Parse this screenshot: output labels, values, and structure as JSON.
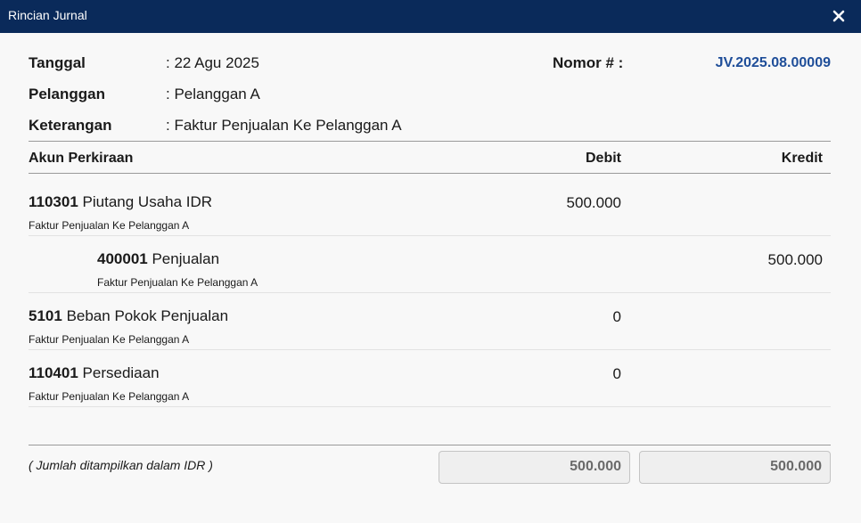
{
  "window": {
    "title": "Rincian Jurnal",
    "close_icon": "close-icon"
  },
  "header": {
    "tanggal_label": "Tanggal",
    "tanggal_value": ": 22 Agu 2025",
    "pelanggan_label": "Pelanggan",
    "pelanggan_value": ": Pelanggan A",
    "keterangan_label": "Keterangan",
    "keterangan_value": ": Faktur Penjualan Ke Pelanggan A",
    "nomor_label": "Nomor # :",
    "nomor_value": "JV.2025.08.00009"
  },
  "table": {
    "columns": [
      "Akun Perkiraan",
      "Debit",
      "Kredit"
    ],
    "rows": [
      {
        "code": "110301",
        "name": "Piutang Usaha IDR",
        "desc": "Faktur Penjualan Ke Pelanggan A",
        "debit": "500.000",
        "credit": ""
      },
      {
        "code": "400001",
        "name": "Penjualan",
        "desc": "Faktur Penjualan Ke Pelanggan A",
        "debit": "",
        "credit": "500.000"
      },
      {
        "code": "5101",
        "name": "Beban Pokok Penjualan",
        "desc": "Faktur Penjualan Ke Pelanggan A",
        "debit": "0",
        "credit": ""
      },
      {
        "code": "110401",
        "name": "Persediaan",
        "desc": "Faktur Penjualan Ke Pelanggan A",
        "debit": "0",
        "credit": ""
      }
    ]
  },
  "footer": {
    "note": "( Jumlah ditampilkan dalam IDR )",
    "total_debit": "500.000",
    "total_credit": "500.000"
  },
  "colors": {
    "titlebar": "#0a2a5a",
    "link": "#1f4e99"
  }
}
